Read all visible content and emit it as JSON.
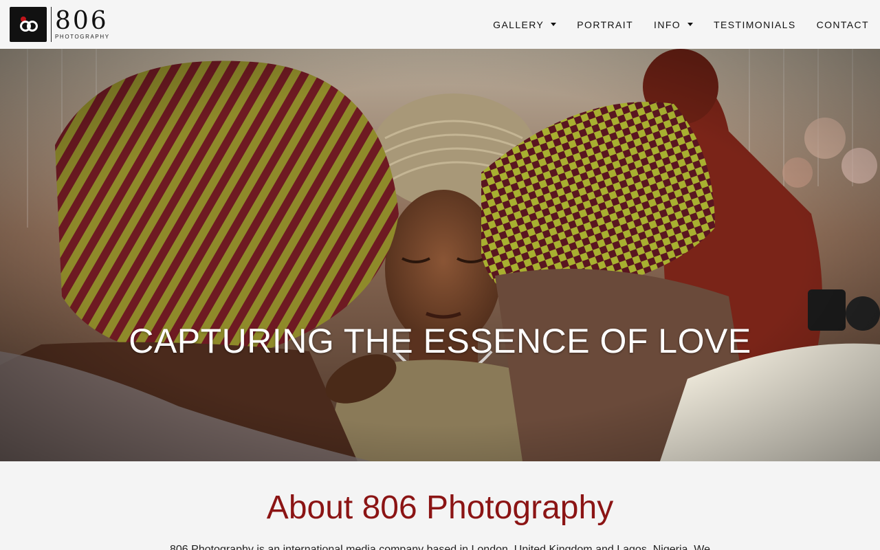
{
  "brand": {
    "number": "806",
    "subtitle": "PHOTOGRAPHY",
    "accent": "#c0151b"
  },
  "nav": {
    "items": [
      {
        "label": "GALLERY",
        "dropdown": true
      },
      {
        "label": "PORTRAIT",
        "dropdown": false
      },
      {
        "label": "INFO",
        "dropdown": true
      },
      {
        "label": "TESTIMONIALS",
        "dropdown": false
      },
      {
        "label": "CONTACT",
        "dropdown": false
      }
    ]
  },
  "hero": {
    "title": "CAPTURING THE ESSENCE OF LOVE"
  },
  "about": {
    "title": "About 806 Photography",
    "title_color": "#8b1414",
    "text": "806 Photography is an international media company based in London, United Kingdom and Lagos, Nigeria. We"
  }
}
